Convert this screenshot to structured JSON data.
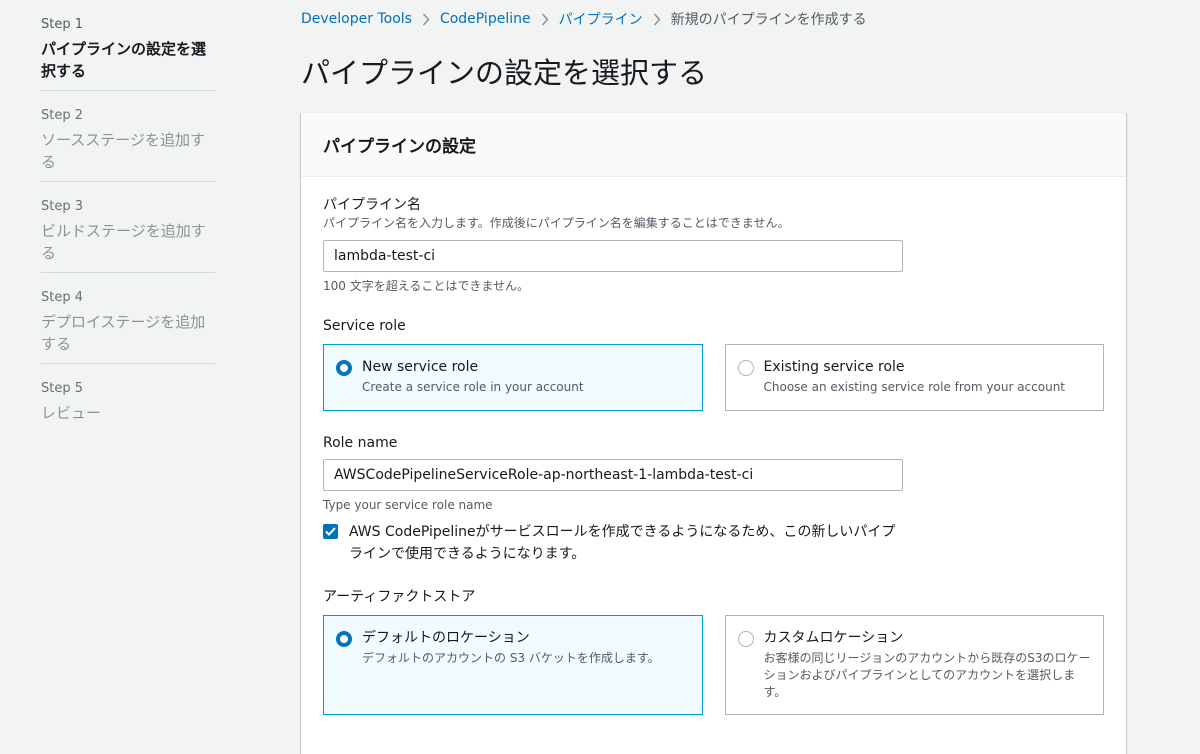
{
  "wizard": {
    "steps": [
      {
        "num": "Step 1",
        "title": "パイプラインの設定を選択する"
      },
      {
        "num": "Step 2",
        "title": "ソースステージを追加する"
      },
      {
        "num": "Step 3",
        "title": "ビルドステージを追加する"
      },
      {
        "num": "Step 4",
        "title": "デプロイステージを追加する"
      },
      {
        "num": "Step 5",
        "title": "レビュー"
      }
    ]
  },
  "breadcrumb": {
    "items": [
      "Developer Tools",
      "CodePipeline",
      "パイプライン",
      "新規のパイプラインを作成する"
    ]
  },
  "page": {
    "title": "パイプラインの設定を選択する"
  },
  "panel": {
    "title": "パイプラインの設定",
    "pipeline_name": {
      "label": "パイプライン名",
      "description": "パイプライン名を入力します。作成後にパイプライン名を編集することはできません。",
      "value": "lambda-test-ci",
      "constraint": "100 文字を超えることはできません。"
    },
    "service_role": {
      "label": "Service role",
      "options": [
        {
          "title": "New service role",
          "desc": "Create a service role in your account",
          "selected": true
        },
        {
          "title": "Existing service role",
          "desc": "Choose an existing service role from your account",
          "selected": false
        }
      ]
    },
    "role_name": {
      "label": "Role name",
      "value": "AWSCodePipelineServiceRole-ap-northeast-1-lambda-test-ci",
      "hint": "Type your service role name"
    },
    "checkbox": {
      "label": "AWS CodePipelineがサービスロールを作成できるようになるため、この新しいパイプラインで使用できるようになります。",
      "checked": true
    },
    "artifact_store": {
      "label": "アーティファクトストア",
      "options": [
        {
          "title": "デフォルトのロケーション",
          "desc": "デフォルトのアカウントの S3 バケットを作成します。",
          "selected": true
        },
        {
          "title": "カスタムロケーション",
          "desc": "お客様の同じリージョンのアカウントから既存のS3のロケーションおよびパイプラインとしてのアカウントを選択します。",
          "selected": false
        }
      ]
    }
  },
  "colors": {
    "link": "#0073bb",
    "selected_border": "#00a1c9",
    "selected_bg": "#f1faff"
  }
}
